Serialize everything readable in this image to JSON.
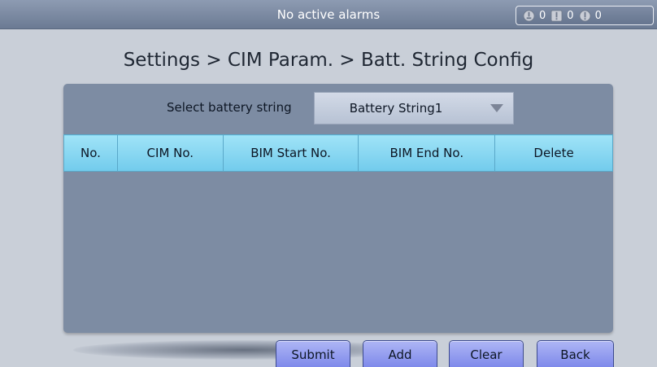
{
  "alarm_bar": {
    "message": "No active alarms",
    "counts": [
      {
        "icon": "minor-alarm-icon",
        "value": "0"
      },
      {
        "icon": "major-alarm-icon",
        "value": "0"
      },
      {
        "icon": "critical-alarm-icon",
        "value": "0"
      }
    ]
  },
  "page": {
    "title": "Settings > CIM Param. > Batt. String Config"
  },
  "selector": {
    "label": "Select battery string",
    "value": "Battery String1"
  },
  "table": {
    "columns": [
      "No.",
      "CIM No.",
      "BIM Start No.",
      "BIM End No.",
      "Delete"
    ],
    "rows": []
  },
  "buttons": {
    "submit": "Submit",
    "add": "Add",
    "clear": "Clear",
    "back": "Back"
  },
  "colors": {
    "header_cell": "#86d6f1",
    "panel": "#7d8ca3",
    "button": "#959ff0",
    "background": "#c9cfd8"
  }
}
